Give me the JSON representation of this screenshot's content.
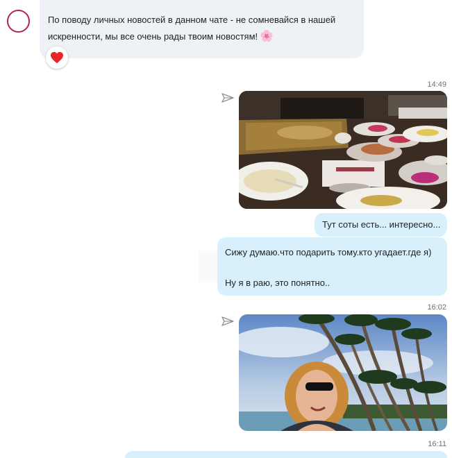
{
  "incoming": {
    "text": "По поводу личных новостей в данном чате - не сомневайся в нашей искренности, мы все очень рады твоим новостям!",
    "emoji": "🌸",
    "reaction": "heart"
  },
  "times": [
    "14:49",
    "16:02",
    "16:11"
  ],
  "outgoing": {
    "caption": "Тут соты есть... интересно...",
    "line1": "Сижу думаю.что подарить тому.кто угадает.где я)",
    "line2": "Ну я в раю, это понятно.."
  },
  "icons": {
    "sent_status": "paper-plane-outline-icon",
    "reaction": "heart-icon"
  },
  "colors": {
    "incoming_bubble": "#eef1f5",
    "outgoing_bubble": "#d8f0fb",
    "heart": "#e8262a",
    "avatar_ring": "#b3234a"
  }
}
